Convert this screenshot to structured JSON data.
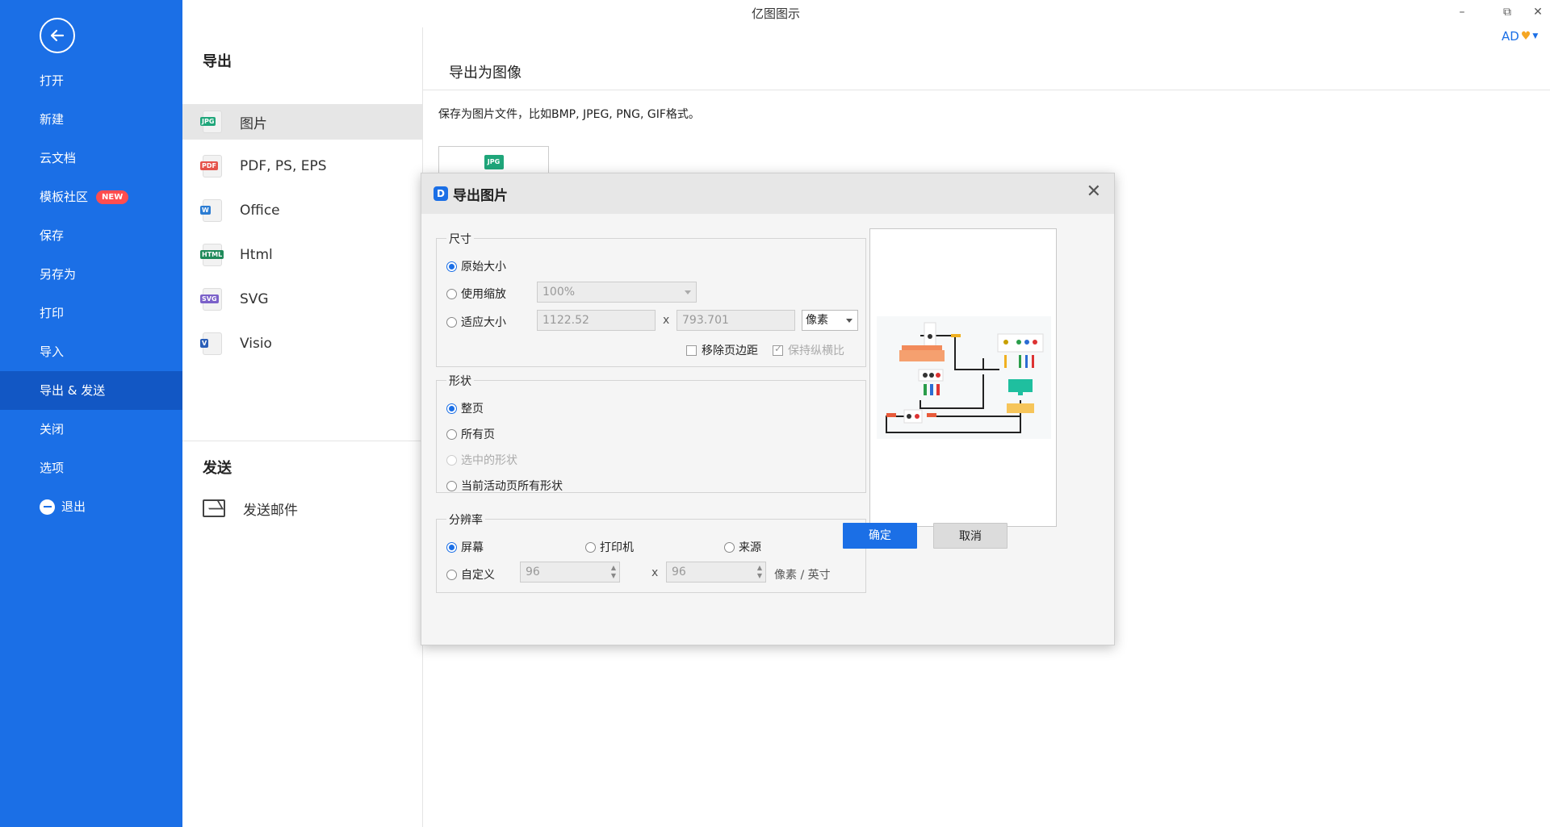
{
  "app": {
    "title": "亿图图示",
    "user": "AD"
  },
  "sidebar": {
    "items": [
      {
        "label": "打开"
      },
      {
        "label": "新建"
      },
      {
        "label": "云文档"
      },
      {
        "label": "模板社区",
        "badge": "NEW"
      },
      {
        "label": "保存"
      },
      {
        "label": "另存为"
      },
      {
        "label": "打印"
      },
      {
        "label": "导入"
      },
      {
        "label": "导出 & 发送"
      },
      {
        "label": "关闭"
      },
      {
        "label": "选项"
      },
      {
        "label": "退出"
      }
    ]
  },
  "export_panel": {
    "heading": "导出",
    "items": [
      {
        "label": "图片",
        "tag": "JPG",
        "color": "#1fa67a"
      },
      {
        "label": "PDF, PS, EPS",
        "tag": "PDF",
        "color": "#e5534b"
      },
      {
        "label": "Office",
        "tag": "W",
        "color": "#2b7cd3"
      },
      {
        "label": "Html",
        "tag": "HTML",
        "color": "#1f8a5a"
      },
      {
        "label": "SVG",
        "tag": "SVG",
        "color": "#7b61c9"
      },
      {
        "label": "Visio",
        "tag": "V",
        "color": "#2b5fb8"
      }
    ],
    "send_heading": "发送",
    "send_items": [
      {
        "label": "发送邮件"
      }
    ]
  },
  "content": {
    "heading": "导出为图像",
    "description": "保存为图片文件，比如BMP, JPEG, PNG, GIF格式。",
    "thumb_tag": "JPG"
  },
  "dialog": {
    "title": "导出图片",
    "size_group": {
      "title": "尺寸",
      "original": "原始大小",
      "use_zoom": "使用缩放",
      "zoom_value": "100%",
      "fit_size": "适应大小",
      "width": "1122.52",
      "height": "793.701",
      "times": "x",
      "unit": "像素",
      "remove_margin": "移除页边距",
      "keep_ratio": "保持纵横比"
    },
    "shape_group": {
      "title": "形状",
      "whole_page": "整页",
      "all_pages": "所有页",
      "selected_shapes": "选中的形状",
      "current_page_shapes": "当前活动页所有形状"
    },
    "resolution_group": {
      "title": "分辨率",
      "screen": "屏幕",
      "printer": "打印机",
      "source": "来源",
      "custom": "自定义",
      "dpi_x": "96",
      "dpi_y": "96",
      "times": "x",
      "unit": "像素 / 英寸"
    },
    "ok": "确定",
    "cancel": "取消"
  },
  "colors": {
    "accent": "#1b6fe6",
    "sidebar_active": "#1257c4",
    "badge": "#ff4d4f"
  }
}
